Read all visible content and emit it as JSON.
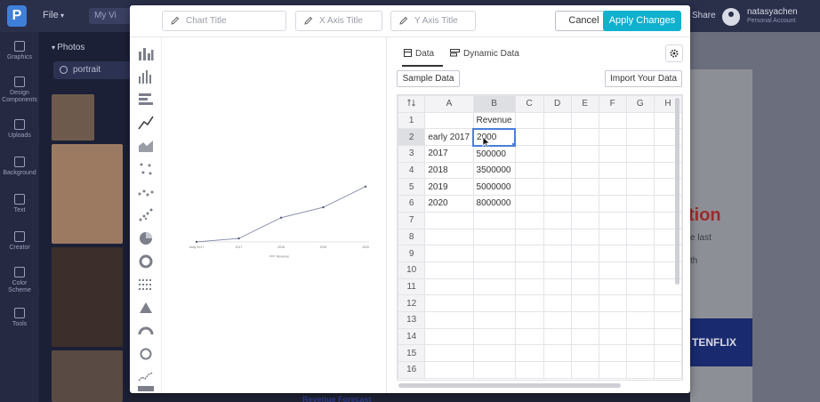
{
  "app": {
    "file_menu": "File",
    "doc_field": "My Vi",
    "share": "Share",
    "user_name": "natasyachen",
    "user_sub": "Personal Account"
  },
  "left_nav": [
    {
      "label": "Graphics"
    },
    {
      "label": "Design Components"
    },
    {
      "label": "Uploads"
    },
    {
      "label": "Background"
    },
    {
      "label": "Text"
    },
    {
      "label": "Creator"
    },
    {
      "label": "Color Scheme"
    },
    {
      "label": "Tools"
    }
  ],
  "assets": {
    "heading": "Photos",
    "search_value": "portrait"
  },
  "background_canvas": {
    "big_text": "tion",
    "line1": "e last",
    "line2": "th",
    "banner": "TENFLIX",
    "forecast": "Revenue Forecast"
  },
  "modal": {
    "chart_title_placeholder": "Chart Title",
    "x_axis_placeholder": "X Axis Title",
    "y_axis_placeholder": "Y Axis Title",
    "cancel_label": "Cancel",
    "apply_label": "Apply Changes",
    "tabs": [
      {
        "label": "Data",
        "active": true
      },
      {
        "label": "Dynamic Data",
        "active": false
      }
    ],
    "sample_data_label": "Sample Data",
    "import_label": "Import Your Data",
    "accent_color": "#0fb1cf"
  },
  "sheet": {
    "columns": [
      "A",
      "B",
      "C",
      "D",
      "E",
      "F",
      "G",
      "H"
    ],
    "rows": [
      [
        "",
        "Revenue"
      ],
      [
        "early 2017",
        "2000"
      ],
      [
        "2017",
        "500000"
      ],
      [
        "2018",
        "3500000"
      ],
      [
        "2019",
        "5000000"
      ],
      [
        "2020",
        "8000000"
      ],
      [],
      [],
      [],
      [],
      [],
      [],
      [],
      [],
      [],
      []
    ],
    "active_cell": "B2"
  },
  "chart_data": {
    "type": "line",
    "categories": [
      "early 2017",
      "2017",
      "2018",
      "2019",
      "2020"
    ],
    "series": [
      {
        "name": "Revenue",
        "values": [
          2000,
          500000,
          3500000,
          5000000,
          8000000
        ]
      }
    ],
    "ylim": [
      0,
      9000000
    ],
    "grid": false,
    "legend": "bottom"
  }
}
